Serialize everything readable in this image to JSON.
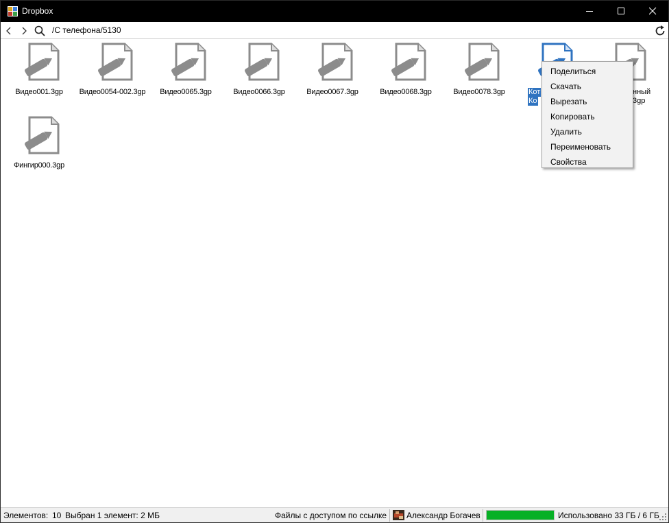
{
  "window": {
    "title": "Dropbox",
    "app_icon": "dropbox-app-icon"
  },
  "nav": {
    "path": "/С телефона/5130"
  },
  "files": [
    {
      "name": "Видео001.3gp"
    },
    {
      "name": "Видео0054-002.3gp"
    },
    {
      "name": "Видео0065.3gp"
    },
    {
      "name": "Видео0066.3gp"
    },
    {
      "name": "Видео0067.3gp"
    },
    {
      "name": "Видео0068.3gp"
    },
    {
      "name": "Видео0078.3gp"
    },
    {
      "name_line1": "Кот",
      "name_line2": "Ко",
      "selected": true
    },
    {
      "name_line1": "нный",
      "name_line2": "3gp"
    },
    {
      "name": "Фингир000.3gp"
    }
  ],
  "context_menu": {
    "items": [
      "Поделиться",
      "Скачать",
      "Вырезать",
      "Копировать",
      "Удалить",
      "Переименовать",
      "Свойства"
    ]
  },
  "status": {
    "items_label": "Элементов:",
    "items_count": "10",
    "selected_text": "Выбран 1 элемент: 2 МБ",
    "shared_link": "Файлы с доступом по ссылке",
    "user_name": "Александр Богачев",
    "usage_text": "Использовано 33 ГБ / 6 ГБ",
    "usage_fraction": 1.0,
    "usage_color": "#06b025"
  },
  "colors": {
    "selection": "#2f73c0",
    "icon_gray": "#8c8c8c"
  }
}
